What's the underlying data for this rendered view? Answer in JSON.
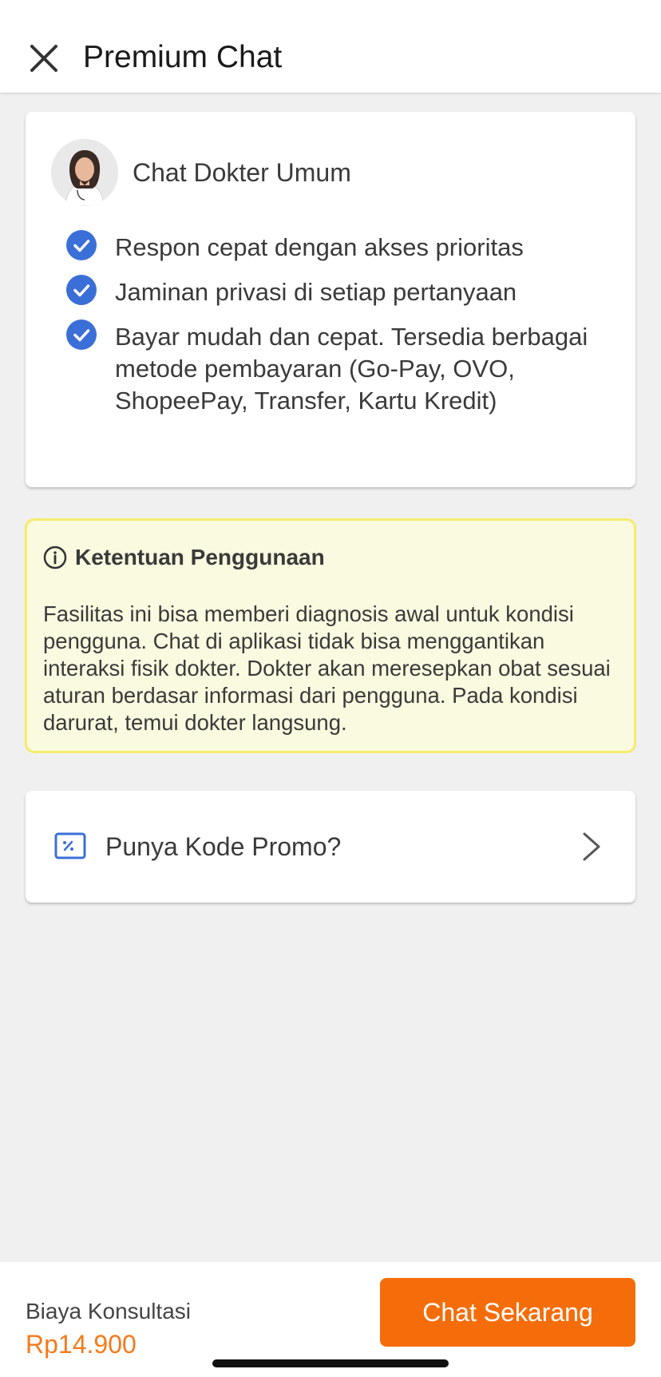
{
  "header": {
    "title": "Premium Chat",
    "close_icon": "close-icon"
  },
  "service": {
    "name": "Chat Dokter Umum",
    "features": [
      "Respon cepat dengan akses prioritas",
      "Jaminan privasi di setiap pertanyaan",
      "Bayar mudah dan cepat. Tersedia berbagai metode pembayaran (Go-Pay, OVO, ShopeePay, Transfer, Kartu Kredit)"
    ]
  },
  "notice": {
    "title": "Ketentuan Penggunaan",
    "body": "Fasilitas ini bisa memberi diagnosis awal untuk kondisi pengguna. Chat di aplikasi tidak bisa menggantikan interaksi fisik dokter. Dokter akan meresepkan obat sesuai aturan berdasar informasi dari pengguna. Pada kondisi darurat, temui dokter langsung."
  },
  "promo": {
    "label": "Punya Kode Promo?"
  },
  "footer": {
    "fee_label": "Biaya Konsultasi",
    "fee_value": "Rp14.900",
    "cta_label": "Chat Sekarang"
  },
  "colors": {
    "accent": "#f56d0a",
    "price": "#f47a1a",
    "check": "#3b6fd8",
    "notice_bg": "#fafae0",
    "notice_border": "#f5ec6a"
  }
}
